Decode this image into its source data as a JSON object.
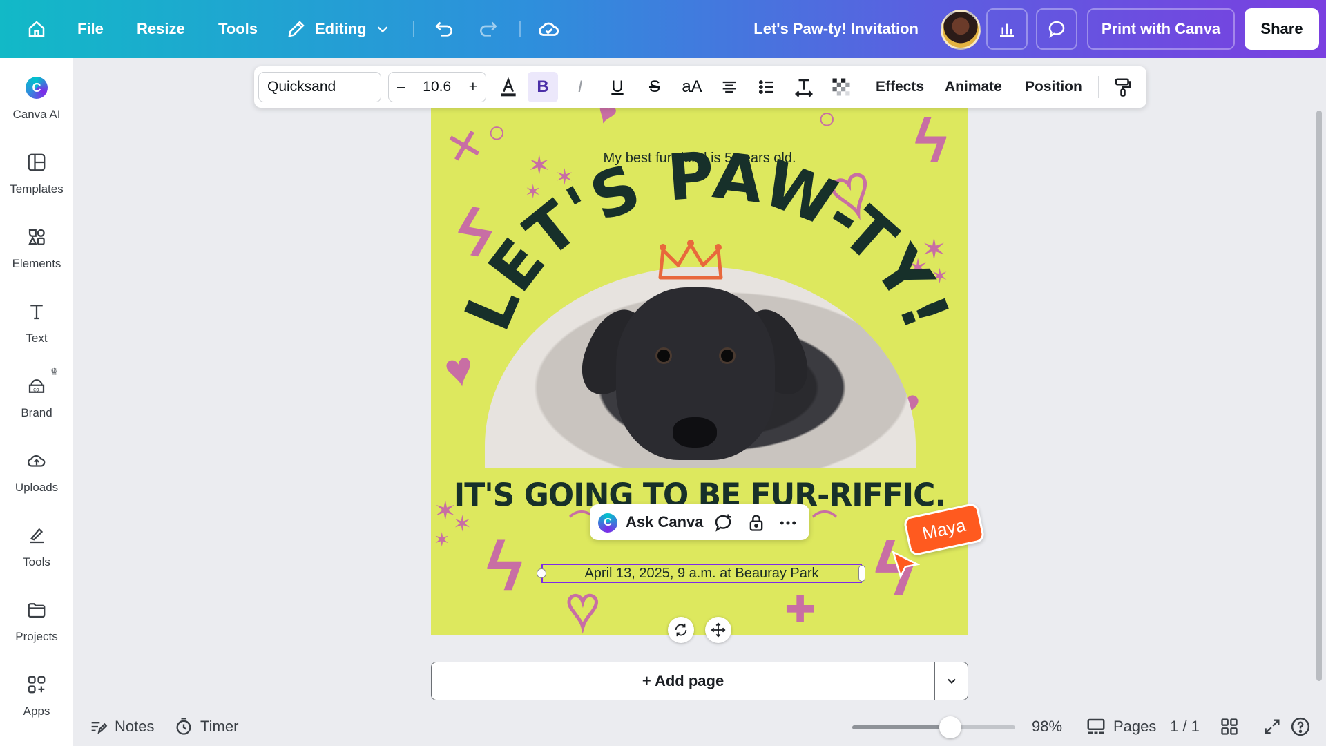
{
  "topbar": {
    "menu": [
      {
        "label": "File"
      },
      {
        "label": "Resize"
      },
      {
        "label": "Tools"
      }
    ],
    "editing_label": "Editing",
    "design_title": "Let's Paw-ty! Invitation",
    "print_label": "Print with Canva",
    "share_label": "Share"
  },
  "sidebar": {
    "items": [
      {
        "label": "Canva AI",
        "icon": "canva-ai-icon"
      },
      {
        "label": "Templates",
        "icon": "templates-icon"
      },
      {
        "label": "Elements",
        "icon": "elements-icon"
      },
      {
        "label": "Text",
        "icon": "text-icon"
      },
      {
        "label": "Brand",
        "icon": "brand-icon"
      },
      {
        "label": "Uploads",
        "icon": "uploads-icon"
      },
      {
        "label": "Tools",
        "icon": "tools-icon"
      },
      {
        "label": "Projects",
        "icon": "projects-icon"
      },
      {
        "label": "Apps",
        "icon": "apps-icon"
      }
    ]
  },
  "text_toolbar": {
    "font": "Quicksand",
    "font_size": "10.6",
    "minus": "–",
    "plus": "+",
    "bold": "B",
    "italic": "I",
    "underline": "U",
    "strike": "S",
    "case": "aA",
    "effects": "Effects",
    "animate": "Animate",
    "position": "Position"
  },
  "design": {
    "small_text": "My best fur-riend is 5 years old.",
    "headline": "LET'S PAW-TY!",
    "tagline": "IT'S GOING TO BE FUR-RIFFIC.",
    "date_text": "April 13, 2025, 9 a.m. at Beauray Park",
    "bg_color": "#dde85e",
    "accent_color": "#c86ea4"
  },
  "ask_canva": {
    "label": "Ask Canva"
  },
  "collaborator": {
    "name": "Maya",
    "color": "#ff5a1f"
  },
  "add_page": {
    "label": "+ Add page"
  },
  "bottombar": {
    "notes": "Notes",
    "timer": "Timer",
    "zoom": "98%",
    "zoom_fraction": 0.6,
    "pages": "Pages",
    "page_count": "1 / 1"
  }
}
